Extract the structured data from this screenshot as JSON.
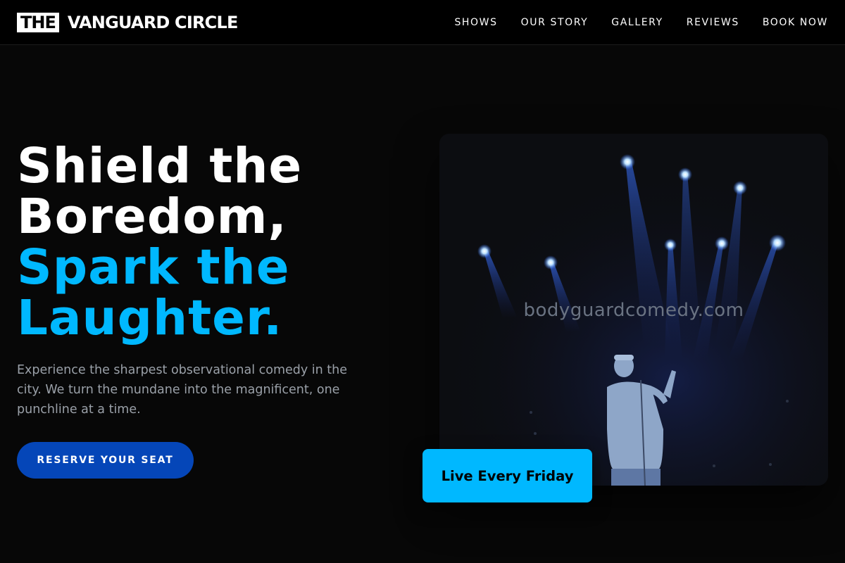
{
  "header": {
    "logo_box": "THE",
    "logo_name": "VANGUARD CIRCLE",
    "nav": [
      "SHOWS",
      "OUR STORY",
      "GALLERY",
      "REVIEWS",
      "BOOK NOW"
    ]
  },
  "hero": {
    "headline_line1": "Shield the",
    "headline_line2": "Boredom,",
    "headline_accent1": "Spark the",
    "headline_accent2": "Laughter.",
    "subcopy": "Experience the sharpest observational comedy in the city. We turn the mundane into the magnificent, one punchline at a time.",
    "cta_label": "RESERVE YOUR SEAT"
  },
  "image": {
    "watermark": "bodyguardcomedy.com",
    "badge": "Live Every Friday"
  },
  "colors": {
    "accent": "#00b8ff",
    "cta": "#0546b8",
    "background": "#070707"
  },
  "icons": [
    "stage-photo"
  ]
}
